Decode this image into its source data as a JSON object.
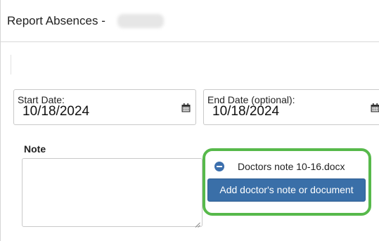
{
  "header": {
    "title": "Report Absences -"
  },
  "start_date": {
    "label": "Start Date:",
    "value": "10/18/2024",
    "icon": "calendar-icon"
  },
  "end_date": {
    "label": "End Date (optional):",
    "value": "10/18/2024",
    "icon": "calendar-icon"
  },
  "note": {
    "label": "Note",
    "value": ""
  },
  "attachments": {
    "files": [
      {
        "name": "Doctors note 10-16.docx",
        "icon": "remove-circle-icon"
      }
    ],
    "add_button_label": "Add doctor's note or document",
    "button_color": "#3a6fa8",
    "highlight_color": "#57b94b"
  }
}
